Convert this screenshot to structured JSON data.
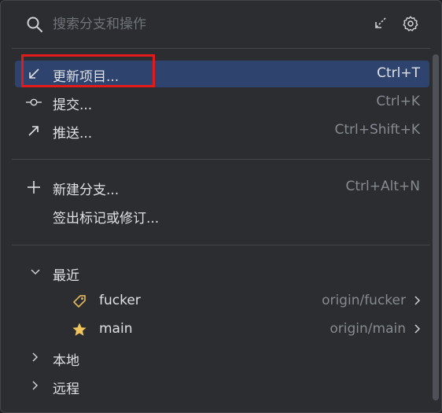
{
  "search": {
    "placeholder": "搜索分支和操作",
    "collapse_icon": "collapse-arrow-icon",
    "settings_icon": "gear-icon"
  },
  "actions": [
    {
      "label": "更新项目...",
      "shortcut": "Ctrl+T",
      "icon": "update-arrow-icon",
      "selected": true
    },
    {
      "label": "提交...",
      "shortcut": "Ctrl+K",
      "icon": "commit-icon"
    },
    {
      "label": "推送...",
      "shortcut": "Ctrl+Shift+K",
      "icon": "push-arrow-icon"
    }
  ],
  "branch_actions": [
    {
      "label": "新建分支...",
      "shortcut": "Ctrl+Alt+N",
      "icon": "plus-icon"
    },
    {
      "label": "签出标记或修订...",
      "shortcut": ""
    }
  ],
  "tree": {
    "recent": {
      "label": "最近",
      "expanded": true,
      "branches": [
        {
          "name": "fucker",
          "remote": "origin/fucker",
          "icon": "tag-icon"
        },
        {
          "name": "main",
          "remote": "origin/main",
          "icon": "star-icon"
        }
      ]
    },
    "local": {
      "label": "本地",
      "expanded": false
    },
    "remote": {
      "label": "远程",
      "expanded": false
    }
  },
  "colors": {
    "background": "#2b2d30",
    "selection": "#2e436e",
    "highlight_box": "#e21a1a",
    "tag_icon": "#e0b35b",
    "star_icon": "#f2c55c"
  }
}
